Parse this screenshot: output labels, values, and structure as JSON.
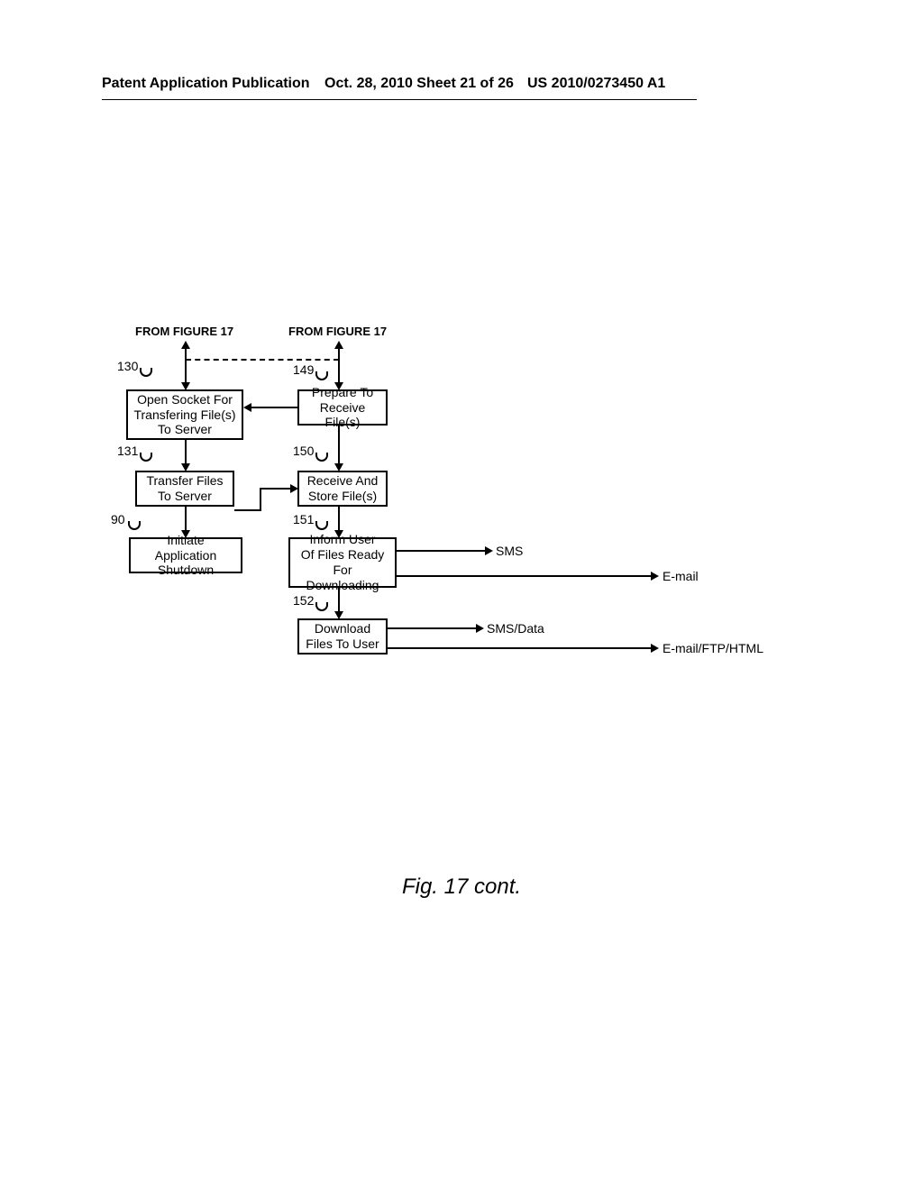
{
  "header": {
    "left": "Patent Application Publication",
    "mid": "Oct. 28, 2010  Sheet 21 of 26",
    "right": "US 2010/0273450 A1"
  },
  "figure_title": "Fig. 17 cont.",
  "from_labels": {
    "left": "FROM FIGURE 17",
    "right": "FROM FIGURE 17"
  },
  "refs": {
    "b130": "130",
    "b131": "131",
    "b90": "90",
    "b149": "149",
    "b150": "150",
    "b151": "151",
    "b152": "152"
  },
  "boxes": {
    "b130": "Open Socket For\nTransfering File(s)\nTo Server",
    "b131": "Transfer Files\nTo Server",
    "b90": "Initiate Application\nShutdown",
    "b149": "Prepare To\nReceive File(s)",
    "b150": "Receive And\nStore File(s)",
    "b151": "Inform User\nOf Files Ready\nFor Downloading",
    "b152": "Download\nFiles To User"
  },
  "outputs": {
    "sms": "SMS",
    "email": "E-mail",
    "smsdata": "SMS/Data",
    "emailftp": "E-mail/FTP/HTML"
  }
}
